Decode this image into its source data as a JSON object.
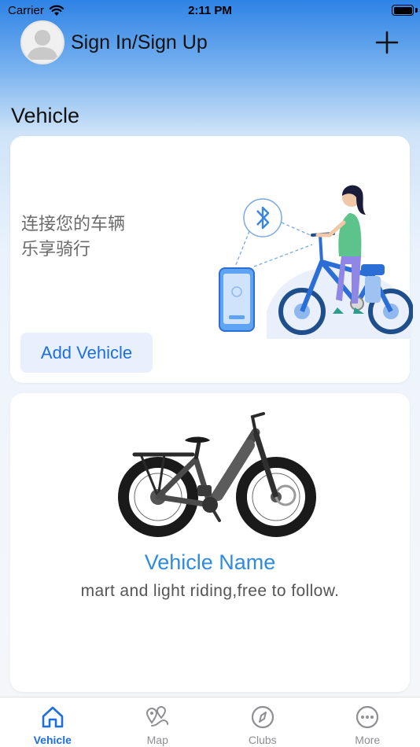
{
  "status_bar": {
    "carrier": "Carrier",
    "time": "2:11 PM"
  },
  "header": {
    "sign_in_label": "Sign In/Sign Up"
  },
  "section": {
    "title": "Vehicle"
  },
  "connect_card": {
    "line1": "连接您的车辆",
    "line2": "乐享骑行",
    "add_button_label": "Add Vehicle"
  },
  "vehicle_card": {
    "name": "Vehicle Name",
    "description": "mart and light riding,free to follow."
  },
  "tabs": [
    {
      "label": "Vehicle",
      "icon": "home-icon",
      "active": true
    },
    {
      "label": "Map",
      "icon": "map-pin-icon",
      "active": false
    },
    {
      "label": "Clubs",
      "icon": "compass-icon",
      "active": false
    },
    {
      "label": "More",
      "icon": "more-dots-icon",
      "active": false
    }
  ],
  "colors": {
    "accent": "#1d6fe0",
    "vehicle_name": "#2e8bdd",
    "header_gradient_top": "#2e83e6"
  }
}
